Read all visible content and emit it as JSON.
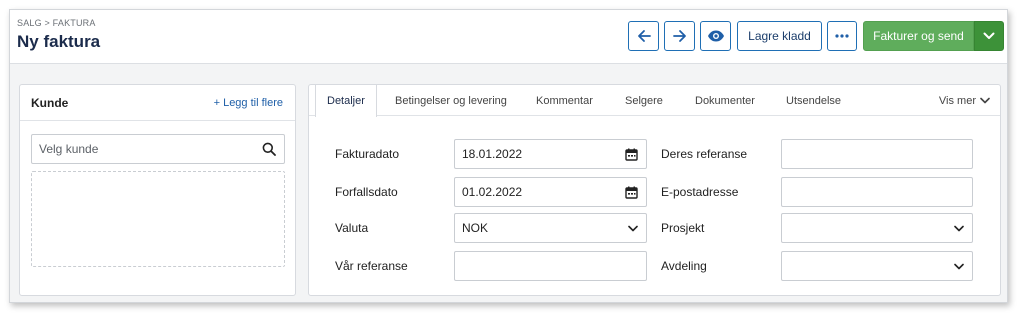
{
  "header": {
    "breadcrumb": "SALG > FAKTURA",
    "title": "Ny faktura",
    "buttons": {
      "back_icon": "arrow-left-icon",
      "forward_icon": "arrow-right-icon",
      "preview_icon": "eye-icon",
      "save_draft": "Lagre kladd",
      "more_icon": "ellipsis-icon",
      "invoice_send": "Fakturer og send",
      "invoice_caret_icon": "chevron-down-icon"
    },
    "colors": {
      "accent": "#1f5fa8",
      "primary_green": "#5fad5c",
      "primary_green_dark": "#3d9239",
      "title": "#1b2b4b"
    }
  },
  "customer_panel": {
    "title": "Kunde",
    "add_link": "+ Legg til flere",
    "search_placeholder": "Velg kunde"
  },
  "tabs": {
    "items": [
      {
        "label": "Detaljer",
        "active": true
      },
      {
        "label": "Betingelser og levering",
        "active": false
      },
      {
        "label": "Kommentar",
        "active": false
      },
      {
        "label": "Selgere",
        "active": false
      },
      {
        "label": "Dokumenter",
        "active": false
      },
      {
        "label": "Utsendelse",
        "active": false
      }
    ],
    "more": "Vis mer"
  },
  "form": {
    "invoice_date": {
      "label": "Fakturadato",
      "value": "18.01.2022"
    },
    "due_date": {
      "label": "Forfallsdato",
      "value": "01.02.2022"
    },
    "currency": {
      "label": "Valuta",
      "value": "NOK"
    },
    "our_reference": {
      "label": "Vår referanse",
      "value": ""
    },
    "their_reference": {
      "label": "Deres referanse",
      "value": ""
    },
    "email": {
      "label": "E-postadresse",
      "value": ""
    },
    "project": {
      "label": "Prosjekt",
      "value": ""
    },
    "department": {
      "label": "Avdeling",
      "value": ""
    }
  }
}
